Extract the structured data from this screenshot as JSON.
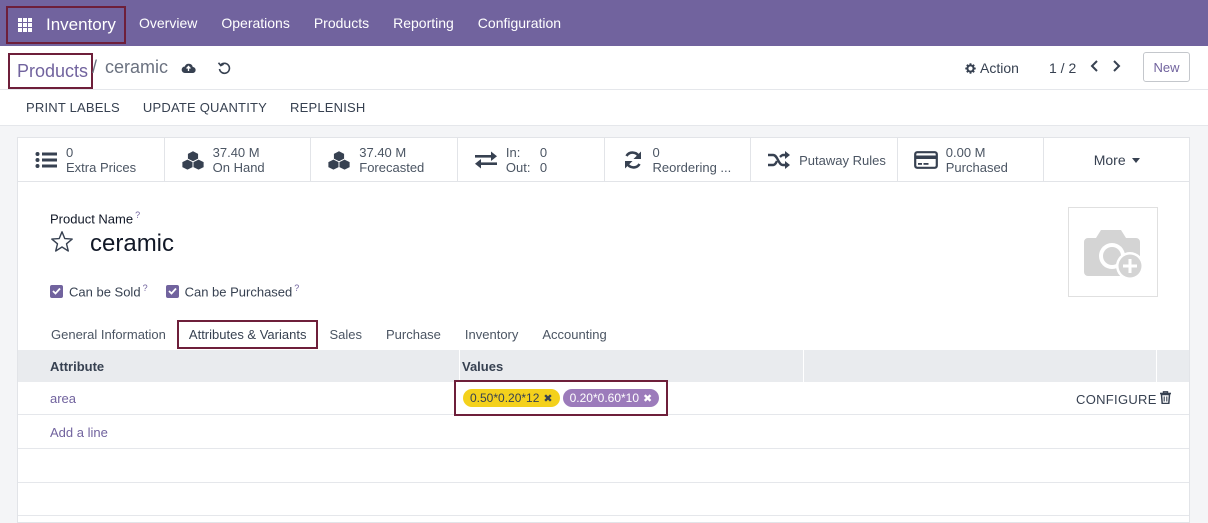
{
  "navbar": {
    "app_name": "Inventory",
    "menu": [
      "Overview",
      "Operations",
      "Products",
      "Reporting",
      "Configuration"
    ]
  },
  "breadcrumb": {
    "parent": "Products",
    "separator": "/",
    "current": "ceramic"
  },
  "control": {
    "action_label": "Action",
    "pager": "1 / 2",
    "new_label": "New"
  },
  "status_buttons": [
    "PRINT LABELS",
    "UPDATE QUANTITY",
    "REPLENISH"
  ],
  "smart_buttons": {
    "extra_prices": {
      "value": "0",
      "label": "Extra Prices",
      "icon": "list-icon"
    },
    "on_hand": {
      "value": "37.40 M",
      "label": "On Hand",
      "icon": "cubes-icon"
    },
    "forecasted": {
      "value": "37.40 M",
      "label": "Forecasted",
      "icon": "cubes-icon"
    },
    "in_out": {
      "in_label": "In:",
      "in_value": "0",
      "out_label": "Out:",
      "out_value": "0",
      "icon": "exchange-icon"
    },
    "reordering": {
      "value": "0",
      "label": "Reordering ...",
      "icon": "refresh-icon"
    },
    "putaway": {
      "label": "Putaway Rules",
      "icon": "random-icon"
    },
    "purchased": {
      "value": "0.00 M",
      "label": "Purchased",
      "icon": "credit-card-icon"
    },
    "more": "More"
  },
  "form": {
    "name_label": "Product Name",
    "help_mark": "?",
    "name": "ceramic",
    "can_be_sold": "Can be Sold",
    "can_be_purchased": "Can be Purchased"
  },
  "tabs": [
    "General Information",
    "Attributes & Variants",
    "Sales",
    "Purchase",
    "Inventory",
    "Accounting"
  ],
  "table": {
    "headers": {
      "attribute": "Attribute",
      "values": "Values"
    },
    "rows": [
      {
        "attribute": "area",
        "values": [
          "0.50*0.20*12",
          "0.20*0.60*10"
        ],
        "configure": "CONFIGURE"
      }
    ],
    "add_line": "Add a line"
  },
  "colors": {
    "brand": "#71639e",
    "tag_yellow": "#f4d11c",
    "tag_purple": "#9c7bbb",
    "highlight": "#6e1f3a"
  }
}
